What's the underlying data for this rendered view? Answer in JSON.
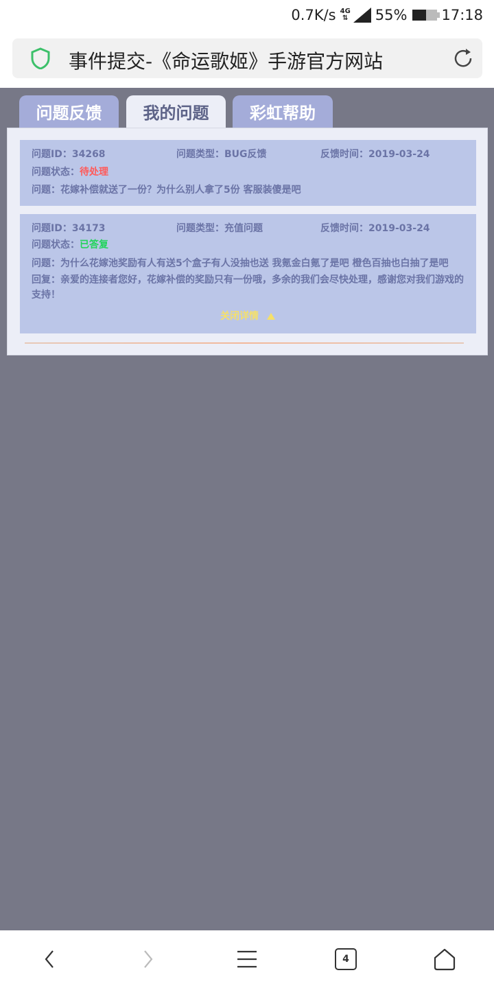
{
  "status_bar": {
    "speed": "0.7K/s",
    "network": "4G",
    "battery_percent": "55%",
    "battery_level": 0.55,
    "time": "17:18"
  },
  "browser": {
    "page_title": "事件提交-《命运歌姬》手游官方网站",
    "secure_icon": "shield-icon",
    "reload_icon": "reload-icon"
  },
  "tabs": [
    {
      "label": "问题反馈",
      "active": false
    },
    {
      "label": "我的问题",
      "active": true
    },
    {
      "label": "彩虹帮助",
      "active": false
    }
  ],
  "issues": [
    {
      "id_label": "问题ID：",
      "id": "34268",
      "type_label": "问题类型：",
      "type": "BUG反馈",
      "time_label": "反馈时间：",
      "time": "2019-03-24",
      "status_label": "问题状态：",
      "status": "待处理",
      "status_color": "#ff5a5a",
      "question_label": "问题：",
      "question": "花嫁补偿就送了一份？为什么别人拿了5份 客服装傻是吧"
    },
    {
      "id_label": "问题ID：",
      "id": "34173",
      "type_label": "问题类型：",
      "type": "充值问题",
      "time_label": "反馈时间：",
      "time": "2019-03-24",
      "status_label": "问题状态：",
      "status": "已答复",
      "status_color": "#22d45b",
      "question_label": "问题：",
      "question": "为什么花嫁池奖励有人有送5个盒子有人没抽也送 我氪金白氪了是吧 橙色百抽也白抽了是吧",
      "reply_label": "回复：",
      "reply": "亲爱的连接者您好，花嫁补偿的奖励只有一份哦，多余的我们会尽快处理，感谢您对我们游戏的支持！",
      "close_label": "关闭详情",
      "close_icon": "triangle-up-icon"
    }
  ],
  "bottom_nav": {
    "tab_count": "4",
    "icons": [
      "back-icon",
      "forward-icon",
      "menu-icon",
      "tabs-icon",
      "home-icon"
    ]
  }
}
